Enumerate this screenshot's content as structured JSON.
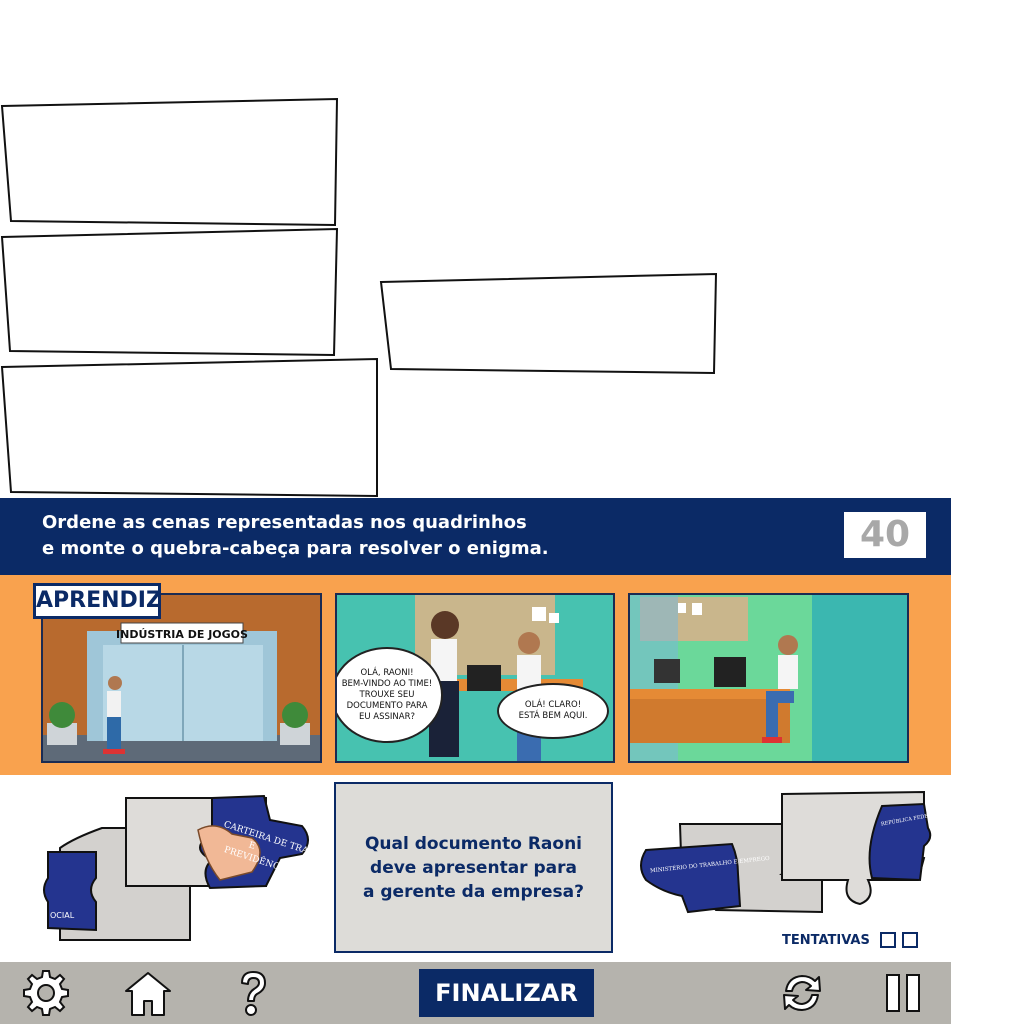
{
  "instructions": {
    "line1": "Ordene as cenas representadas nos quadrinhos",
    "line2": "e monte o quebra-cabeça para resolver o enigma.",
    "score": "40"
  },
  "comic": {
    "logo": "APRENDIZ",
    "panel1": {
      "sign": "INDÚSTRIA DE JOGOS"
    },
    "panel2": {
      "bubble_left": [
        "OLÁ, RAONI!",
        "BEM-VINDO AO TIME!",
        "TROUXE SEU",
        "DOCUMENTO PARA",
        "EU ASSINAR?"
      ],
      "bubble_right": [
        "OLÁ! CLARO!",
        "ESTÁ BEM AQUI."
      ]
    }
  },
  "puzzle": {
    "left_piece_text": [
      "CARTEIRA DE TRABALHO",
      "E",
      "PREVIDÊNCIA"
    ],
    "left_piece_small": "OCIAL",
    "right_piece_text": "MINISTÉRIO DO TRABALHO E EMPREGO",
    "right_piece_text2": "REPÚBLICA FEDERATIVA DO BRASIL",
    "right_piece_text3": "REPÚBLICA FEDERATIVA DO BRASIL"
  },
  "riddle": {
    "line1": "Qual documento Raoni",
    "line2": "deve apresentar para",
    "line3": "a gerente da empresa?"
  },
  "attempts": {
    "label": "TENTATIVAS",
    "total": 2,
    "used": 0
  },
  "toolbar": {
    "settings_icon": "gear-icon",
    "home_icon": "home-icon",
    "help_icon": "question-icon",
    "finalize_label": "FINALIZAR",
    "restart_icon": "refresh-icon",
    "pause_icon": "pause-icon"
  },
  "colors": {
    "navy": "#0b2a66",
    "orange": "#f9a24e",
    "toolbar_gray": "#b5b3ad",
    "card_gray": "#dddcd8"
  }
}
